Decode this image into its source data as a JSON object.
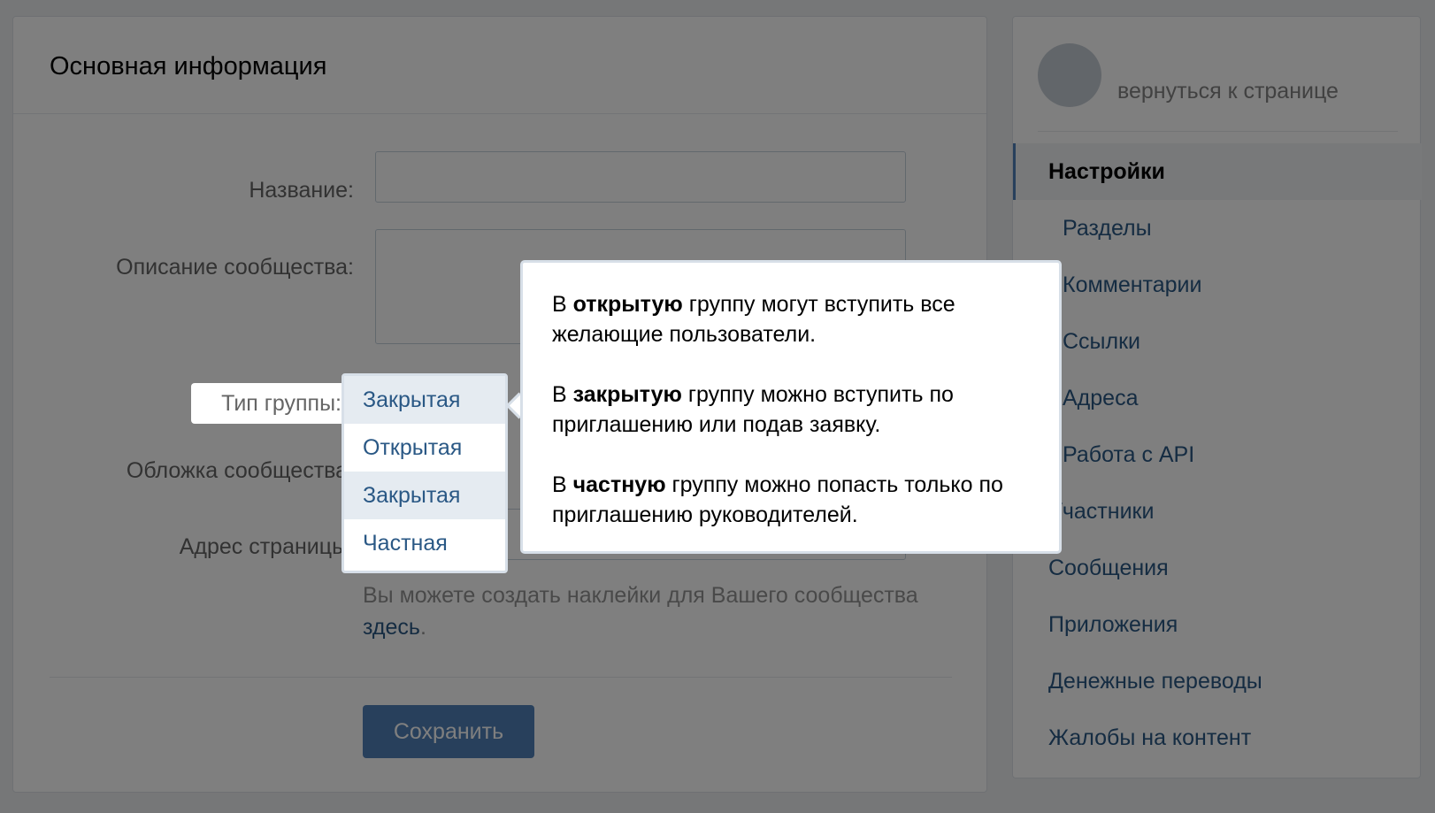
{
  "main": {
    "title": "Основная информация",
    "labels": {
      "name": "Название:",
      "description": "Описание сообщества:",
      "group_type": "Тип группы:",
      "cover": "Обложка сообщества:",
      "address": "Адрес страницы:"
    },
    "hint_text": "Вы можете создать наклейки для Вашего сообщества",
    "hint_link": "здесь",
    "hint_end": ".",
    "save_label": "Сохранить"
  },
  "sidebar": {
    "back_link": "вернуться к странице",
    "items": [
      {
        "label": "Настройки"
      },
      {
        "label": "Разделы"
      },
      {
        "label": "Комментарии"
      },
      {
        "label": "Ссылки"
      },
      {
        "label": "Адреса"
      },
      {
        "label": "Работа с API"
      },
      {
        "label": "Участники"
      },
      {
        "label": "Сообщения"
      },
      {
        "label": "Приложения"
      },
      {
        "label": "Денежные переводы"
      },
      {
        "label": "Жалобы на контент"
      }
    ]
  },
  "dropdown": {
    "options": [
      "Закрытая",
      "Открытая",
      "Закрытая",
      "Частная"
    ]
  },
  "tooltip": {
    "p1_pre": "В ",
    "p1_bold": "открытую",
    "p1_post": " группу могут вступить все желающие пользователи.",
    "p2_pre": "В ",
    "p2_bold": "закрытую",
    "p2_post": " группу можно вступить по приглашению или подав заявку.",
    "p3_pre": "В ",
    "p3_bold": "частную",
    "p3_post": " группу можно попасть только по приглашению руководителей."
  }
}
